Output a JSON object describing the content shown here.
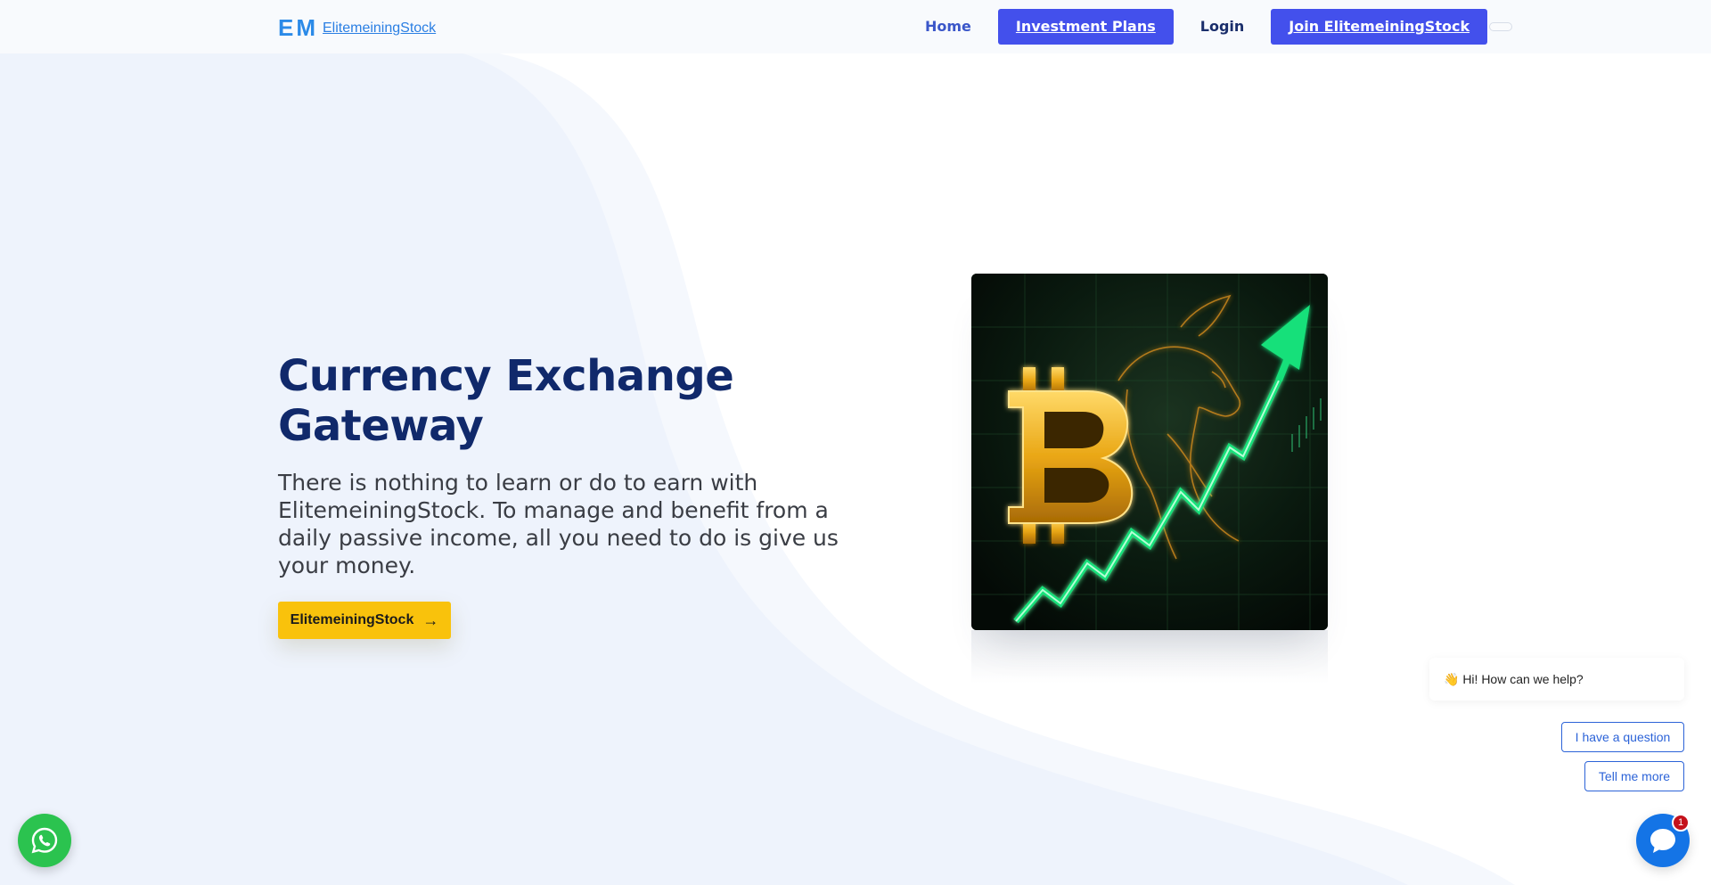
{
  "header": {
    "logo_letters": "EM",
    "brand_name": "ElitemeiningStock",
    "nav": {
      "home": "Home",
      "plans": "Investment Plans",
      "login": "Login",
      "join": "Join ElitemeiningStock"
    }
  },
  "hero": {
    "title": "Currency Exchange Gateway",
    "text": "There is nothing to learn or do to earn with ElitemeiningStock. To manage and benefit from a daily passive income, all you need to do is give us your money.",
    "cta_label": "ElitemeiningStock",
    "cta_icon": "arrow-right-icon",
    "image_icon": "bitcoin-bull-chart-image"
  },
  "chat": {
    "greeting": "👋 Hi! How can we help?",
    "option_question": "I have a question",
    "option_more": "Tell me more",
    "badge_count": "1",
    "launcher_icon": "chat-icon"
  },
  "whatsapp": {
    "icon": "whatsapp-icon"
  },
  "colors": {
    "accent": "#4350ec",
    "title": "#10296b",
    "cta": "#f9c20c",
    "whatsapp": "#2bc34f",
    "chat": "#1474e6"
  }
}
